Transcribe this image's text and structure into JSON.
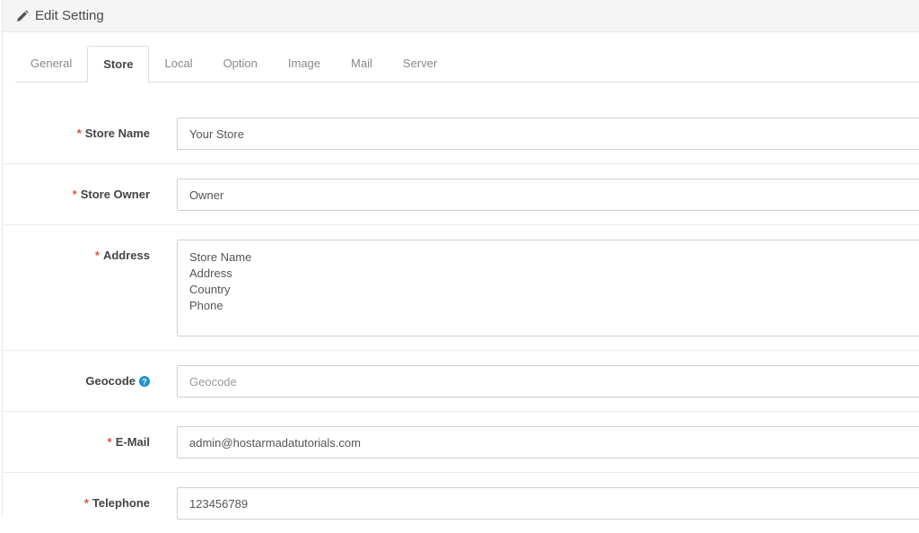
{
  "heading": {
    "title": "Edit Setting",
    "icon": "pencil-icon"
  },
  "tabs": [
    {
      "label": "General",
      "active": false
    },
    {
      "label": "Store",
      "active": true
    },
    {
      "label": "Local",
      "active": false
    },
    {
      "label": "Option",
      "active": false
    },
    {
      "label": "Image",
      "active": false
    },
    {
      "label": "Mail",
      "active": false
    },
    {
      "label": "Server",
      "active": false
    }
  ],
  "form": {
    "store_name": {
      "label": "Store Name",
      "required": "*",
      "value": "Your Store"
    },
    "store_owner": {
      "label": "Store Owner",
      "required": "*",
      "value": "Owner"
    },
    "address": {
      "label": "Address",
      "required": "*",
      "value": "Store Name\nAddress\nCountry\nPhone"
    },
    "geocode": {
      "label": "Geocode",
      "value": "",
      "placeholder": "Geocode",
      "help_icon": "question-circle-icon"
    },
    "email": {
      "label": "E-Mail",
      "required": "*",
      "value": "admin@hostarmadatutorials.com"
    },
    "telephone": {
      "label": "Telephone",
      "required": "*",
      "value": "123456789"
    }
  },
  "colors": {
    "required": "#e3503e",
    "help_icon": "#1e91cf"
  }
}
